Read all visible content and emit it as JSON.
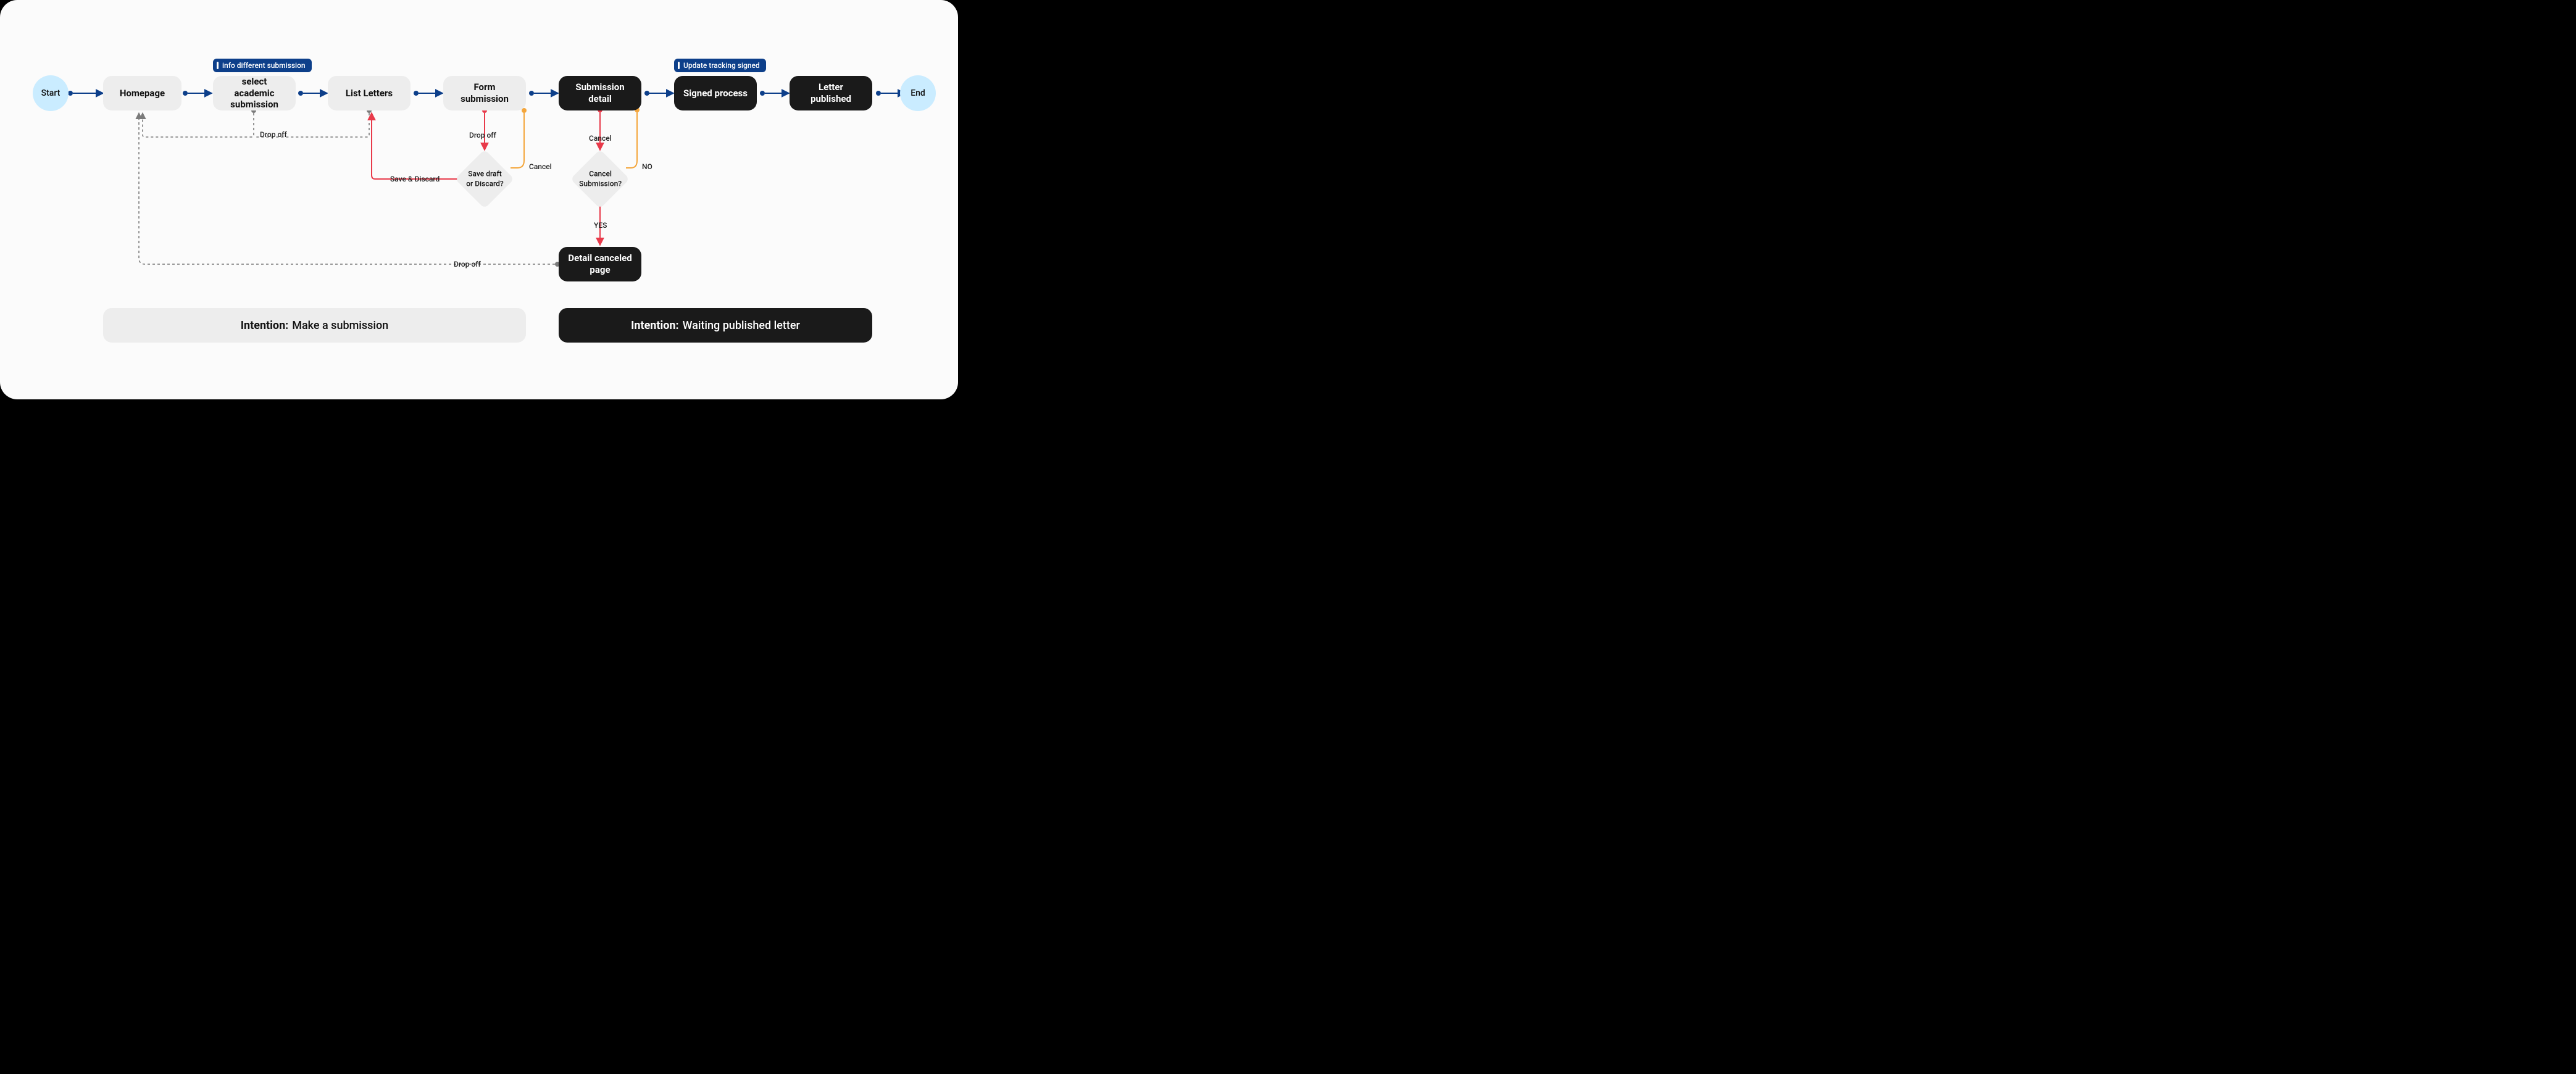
{
  "terminals": {
    "start": "Start",
    "end": "End"
  },
  "tags": {
    "select": "info different submission",
    "signed": "Update tracking signed"
  },
  "nodes": {
    "homepage": "Homepage",
    "select": "select academic submission",
    "listletters": "List Letters",
    "form": "Form submission",
    "subdetail": "Submission detail",
    "signed": "Signed process",
    "published": "Letter published",
    "canceled": "Detail canceled page"
  },
  "decisions": {
    "savedraft": "Save draft\nor Discard?",
    "cancelq": "Cancel\nSubmission?"
  },
  "edge_labels": {
    "dropoff1": "Drop off",
    "dropoff2": "Drop off",
    "dropoff3": "Drop off",
    "save_discard": "Save & Discard",
    "cancel_form": "Cancel",
    "sub_cancel": "Cancel",
    "no": "NO",
    "yes": "YES"
  },
  "intentions": {
    "left_key": "Intention:",
    "left_val": "Make a submission",
    "right_key": "Intention:",
    "right_val": "Waiting published letter"
  },
  "colors": {
    "blue": "#0d3f8a",
    "orange": "#f4a63c",
    "red": "#e83a4a",
    "gray": "#7b7b7b",
    "term": "#caecff"
  }
}
